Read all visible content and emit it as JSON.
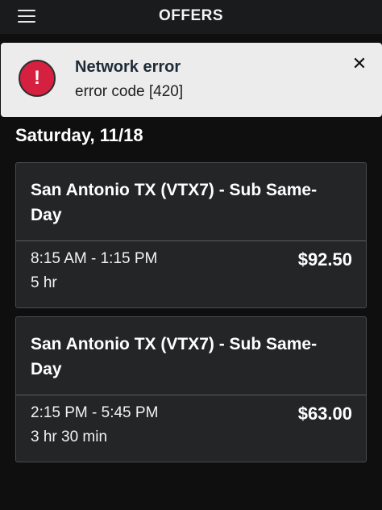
{
  "header": {
    "title": "OFFERS",
    "menu_icon": "hamburger-menu-icon"
  },
  "error_toast": {
    "icon": "exclamation-icon",
    "icon_glyph": "!",
    "title": "Network error",
    "message": "error code [420]",
    "close_glyph": "✕",
    "accent_color": "#d6203f"
  },
  "date_heading": "Saturday, 11/18",
  "offers": [
    {
      "name": "San Antonio TX (VTX7) - Sub Same-Day",
      "time_range": "8:15 AM - 1:15 PM",
      "duration": "5 hr",
      "price": "$92.50"
    },
    {
      "name": "San Antonio TX (VTX7) - Sub Same-Day",
      "time_range": "2:15 PM - 5:45 PM",
      "duration": "3 hr 30 min",
      "price": "$63.00"
    }
  ]
}
